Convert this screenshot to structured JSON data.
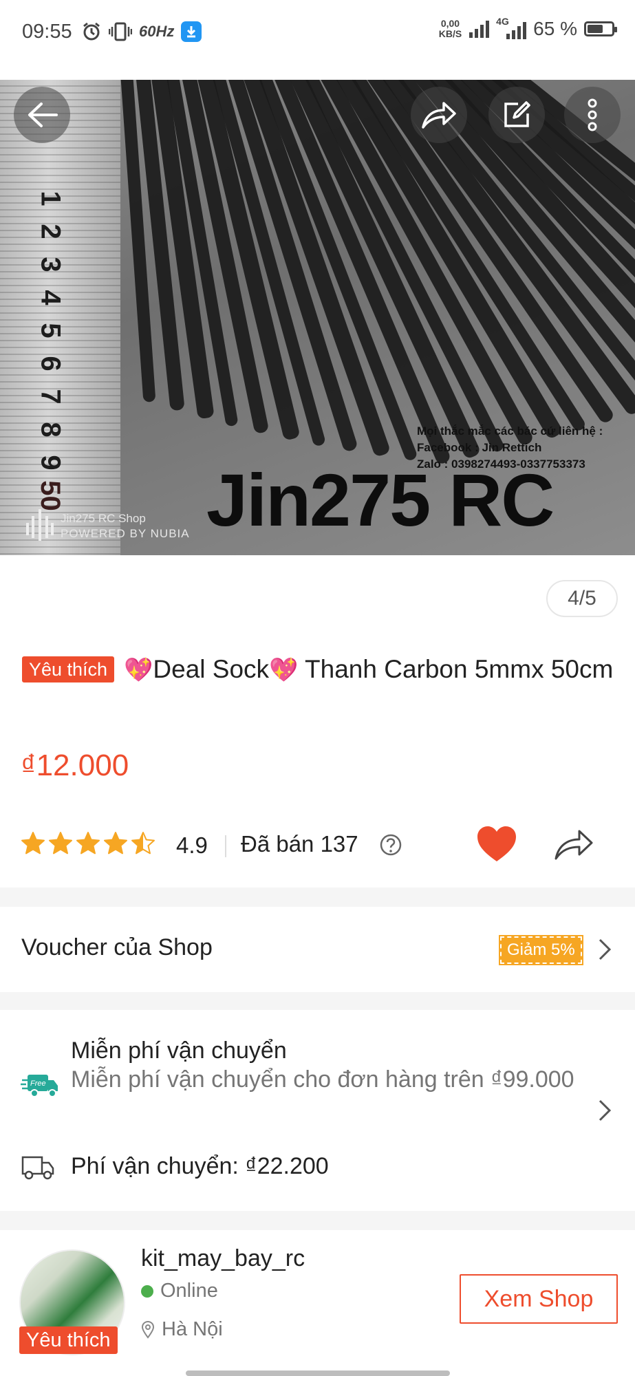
{
  "status_bar": {
    "time": "09:55",
    "refresh": "60Hz",
    "net_speed_value": "0,00",
    "net_speed_unit": "KB/S",
    "network": "4G",
    "battery_text": "65 %",
    "battery_level": 0.65
  },
  "hero": {
    "watermark_shop": "Jin275 RC Shop",
    "watermark_powered": "POWERED BY NUBIA",
    "contact_line1": "Mọi thắc mắc các bác cứ liên hệ :",
    "contact_line2": "Facebook : Jin Rettich",
    "contact_line3": "Zalo : 0398274493-0337753373",
    "brand": "Jin275 RC",
    "ruler_numbers": [
      "1",
      "2",
      "3",
      "4",
      "5",
      "6",
      "7",
      "8",
      "9",
      "50"
    ]
  },
  "gallery": {
    "counter": "4/5"
  },
  "product": {
    "badge": "Yêu thích",
    "title_emoji": "💖",
    "title_part1": "Deal Sock",
    "title_part2": "Thanh Carbon 5mmx 50cm",
    "price": "₫12.000",
    "rating": "4.9",
    "rating_stars": 4.5,
    "sold": "Đã bán 137"
  },
  "voucher": {
    "label": "Voucher của Shop",
    "badge": "Giảm 5%"
  },
  "shipping": {
    "free_title": "Miễn phí vận chuyển",
    "free_sub": "Miễn phí vận chuyển cho đơn hàng trên ₫99.000",
    "free_icon_text": "Free",
    "fee": "Phí vận chuyển: ₫22.200"
  },
  "shop": {
    "name": "kit_may_bay_rc",
    "status": "Online",
    "location": "Hà Nội",
    "badge": "Yêu thích",
    "view_button": "Xem Shop"
  },
  "colors": {
    "accent": "#ee4d2d",
    "voucher": "#f6a623",
    "star": "#f6a623",
    "online": "#4cae4c"
  }
}
